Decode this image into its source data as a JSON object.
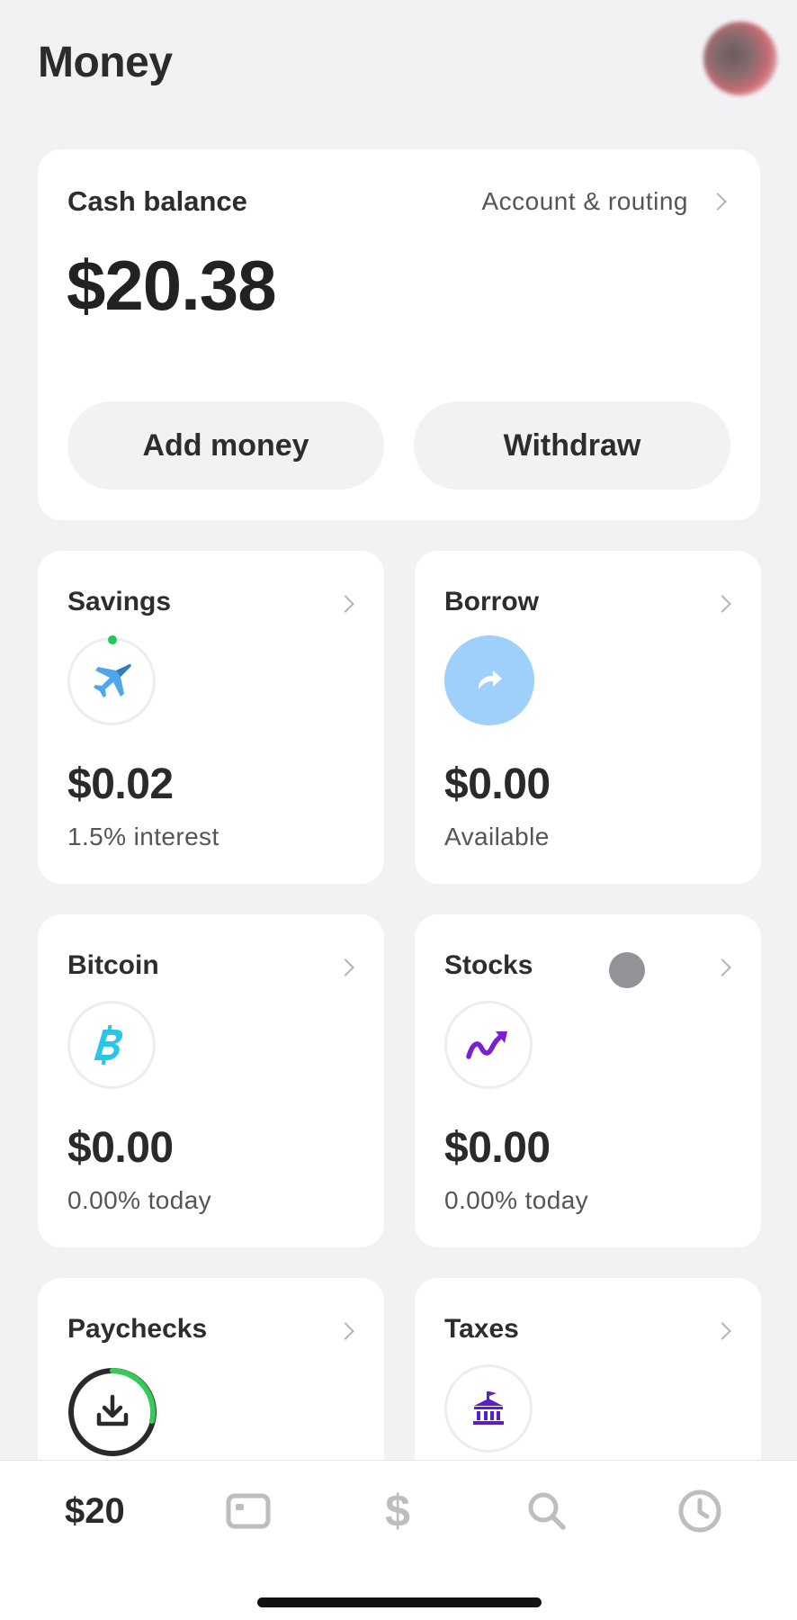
{
  "header": {
    "title": "Money"
  },
  "cash": {
    "label": "Cash balance",
    "routing_link": "Account & routing",
    "amount": "$20.38",
    "add_label": "Add money",
    "withdraw_label": "Withdraw"
  },
  "tiles": {
    "savings": {
      "title": "Savings",
      "amount": "$0.02",
      "sub": "1.5% interest",
      "icon": "airplane-icon"
    },
    "borrow": {
      "title": "Borrow",
      "amount": "$0.00",
      "sub": "Available",
      "icon": "curved-arrow-icon"
    },
    "bitcoin": {
      "title": "Bitcoin",
      "amount": "$0.00",
      "sub": "0.00% today",
      "icon": "bitcoin-icon"
    },
    "stocks": {
      "title": "Stocks",
      "amount": "$0.00",
      "sub": "0.00% today",
      "icon": "trend-up-icon"
    },
    "paychecks": {
      "title": "Paychecks",
      "icon": "download-icon"
    },
    "taxes": {
      "title": "Taxes",
      "icon": "bank-building-icon"
    }
  },
  "bottom_nav": {
    "balance": "$20",
    "dollar_glyph": "$",
    "items": [
      "balance",
      "card",
      "pay",
      "search",
      "activity"
    ]
  },
  "colors": {
    "background": "#f2f2f5",
    "card": "#ffffff",
    "savings_accent": "#1ec95a",
    "borrow_circle": "#9fd0fb",
    "bitcoin": "#2bc4ea",
    "stocks": "#7b1fd6",
    "taxes": "#5a1fc9"
  }
}
